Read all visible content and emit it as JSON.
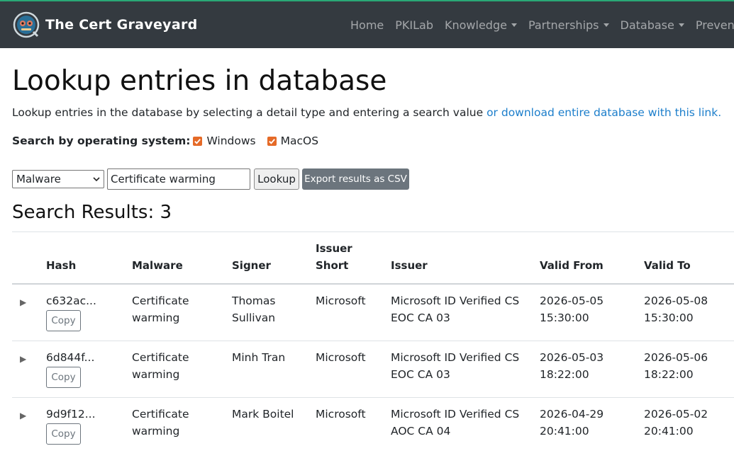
{
  "navbar": {
    "brand": "The Cert Graveyard",
    "items": [
      {
        "label": "Home",
        "dropdown": false
      },
      {
        "label": "PKILab",
        "dropdown": false
      },
      {
        "label": "Knowledge",
        "dropdown": true
      },
      {
        "label": "Partnerships",
        "dropdown": true
      },
      {
        "label": "Database",
        "dropdown": true
      },
      {
        "label": "Prevention",
        "dropdown": false
      }
    ]
  },
  "page": {
    "title": "Lookup entries in database",
    "intro_text": "Lookup entries in the database by selecting a detail type and entering a search value ",
    "intro_link": "or download entire database with this link.",
    "os_label": "Search by operating system:",
    "os_options": [
      {
        "label": "Windows",
        "checked": true
      },
      {
        "label": "MacOS",
        "checked": true
      }
    ]
  },
  "search": {
    "type_selected": "Malware",
    "value": "Certificate warming",
    "lookup_label": "Lookup",
    "export_label": "Export results as CSV"
  },
  "results": {
    "heading": "Search Results: 3",
    "columns": {
      "hash": "Hash",
      "malware": "Malware",
      "signer": "Signer",
      "issuer_short_1": "Issuer",
      "issuer_short_2": "Short",
      "issuer": "Issuer",
      "valid_from": "Valid From",
      "valid_to": "Valid To"
    },
    "copy_label": "Copy",
    "expander": "▶",
    "rows": [
      {
        "hash": "c632ac...",
        "malware_1": "Certificate",
        "malware_2": "warming",
        "signer_1": "Thomas",
        "signer_2": "Sullivan",
        "issuer_short": "Microsoft",
        "issuer_1": "Microsoft ID Verified CS",
        "issuer_2": "EOC CA 03",
        "from_1": "2026-05-05",
        "from_2": "15:30:00",
        "to_1": "2026-05-08",
        "to_2": "15:30:00"
      },
      {
        "hash": "6d844f...",
        "malware_1": "Certificate",
        "malware_2": "warming",
        "signer_1": "Minh Tran",
        "signer_2": "",
        "issuer_short": "Microsoft",
        "issuer_1": "Microsoft ID Verified CS",
        "issuer_2": "EOC CA 03",
        "from_1": "2026-05-03",
        "from_2": "18:22:00",
        "to_1": "2026-05-06",
        "to_2": "18:22:00"
      },
      {
        "hash": "9d9f12...",
        "malware_1": "Certificate",
        "malware_2": "warming",
        "signer_1": "Mark Boitel",
        "signer_2": "",
        "issuer_short": "Microsoft",
        "issuer_1": "Microsoft ID Verified CS",
        "issuer_2": "AOC CA 04",
        "from_1": "2026-04-29",
        "from_2": "20:41:00",
        "to_1": "2026-05-02",
        "to_2": "20:41:00"
      }
    ]
  }
}
